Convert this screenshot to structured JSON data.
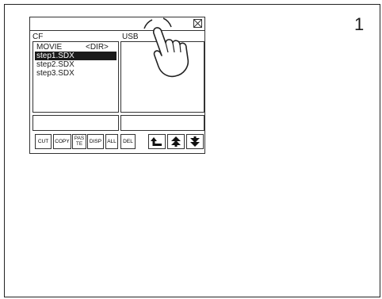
{
  "step": {
    "number": "1"
  },
  "dialog": {
    "left_pane": {
      "label": "CF",
      "items": [
        {
          "name": "MOVIE",
          "tag": "<DIR>"
        },
        {
          "name": "step1.SDX",
          "tag": ""
        },
        {
          "name": "step2.SDX",
          "tag": ""
        },
        {
          "name": "step3.SDX",
          "tag": ""
        }
      ]
    },
    "right_pane": {
      "label": "USB"
    },
    "toolbar": {
      "cut": "CUT",
      "copy": "COPY",
      "paste_line1": "PAS",
      "paste_line2": "TE",
      "disp": "DISP",
      "all": "ALL",
      "del": "DEL"
    }
  },
  "icons": {
    "close": "close-icon",
    "up_folder": "folder-up-icon",
    "scroll_top": "scroll-to-top-icon",
    "scroll_bottom": "scroll-to-bottom-icon",
    "hand": "hand-pointer-icon"
  }
}
